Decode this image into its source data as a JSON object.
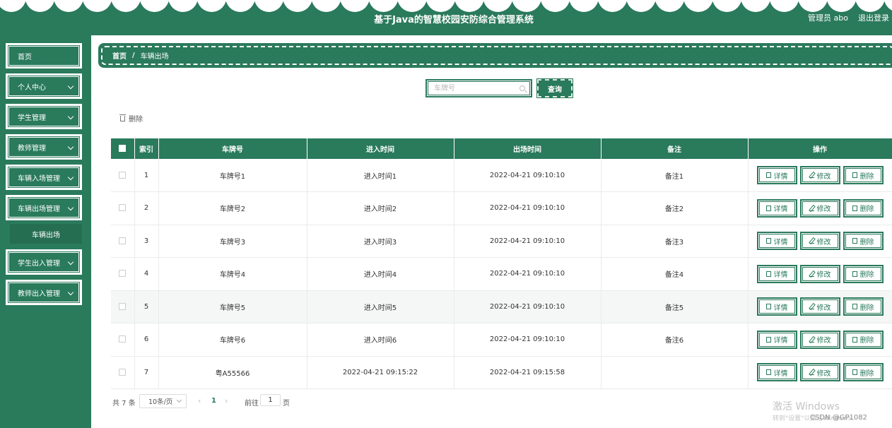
{
  "header": {
    "title": "基于Java的智慧校园安防综合管理系统",
    "admin": "管理员 abo",
    "logout": "退出登录"
  },
  "sidebar": {
    "items": [
      {
        "label": "首页",
        "has_arrow": false
      },
      {
        "label": "个人中心",
        "has_arrow": true
      },
      {
        "label": "学生管理",
        "has_arrow": true
      },
      {
        "label": "教师管理",
        "has_arrow": true
      },
      {
        "label": "车辆入场管理",
        "has_arrow": true
      },
      {
        "label": "车辆出场管理",
        "has_arrow": true
      },
      {
        "label": "学生出入管理",
        "has_arrow": true
      },
      {
        "label": "教师出入管理",
        "has_arrow": true
      }
    ],
    "active_sub": "车辆出场"
  },
  "breadcrumb": {
    "home": "首页",
    "separator": "/",
    "current": "车辆出场"
  },
  "search": {
    "placeholder": "车牌号",
    "value": "",
    "button": "查询"
  },
  "toolbar": {
    "delete": "删除"
  },
  "table": {
    "columns": [
      "索引",
      "车牌号",
      "进入时间",
      "出场时间",
      "备注",
      "操作"
    ],
    "rows": [
      {
        "index": "1",
        "plate": "车牌号1",
        "entry": "进入时间1",
        "exit": "2022-04-21 09:10:10",
        "note": "备注1"
      },
      {
        "index": "2",
        "plate": "车牌号2",
        "entry": "进入时间2",
        "exit": "2022-04-21 09:10:10",
        "note": "备注2"
      },
      {
        "index": "3",
        "plate": "车牌号3",
        "entry": "进入时间3",
        "exit": "2022-04-21 09:10:10",
        "note": "备注3"
      },
      {
        "index": "4",
        "plate": "车牌号4",
        "entry": "进入时间4",
        "exit": "2022-04-21 09:10:10",
        "note": "备注4"
      },
      {
        "index": "5",
        "plate": "车牌号5",
        "entry": "进入时间5",
        "exit": "2022-04-21 09:10:10",
        "note": "备注5"
      },
      {
        "index": "6",
        "plate": "车牌号6",
        "entry": "进入时间6",
        "exit": "2022-04-21 09:10:10",
        "note": "备注6"
      },
      {
        "index": "7",
        "plate": "粤A55566",
        "entry": "2022-04-21 09:15:22",
        "exit": "2022-04-21 09:15:58",
        "note": ""
      }
    ],
    "actions": {
      "detail": "详情",
      "edit": "修改",
      "delete": "删除"
    },
    "highlighted_row": 4
  },
  "pagination": {
    "total": "共 7 条",
    "page_size": "10条/页",
    "current_page": "1",
    "goto_label": "前往",
    "goto_value": "1",
    "page_suffix": "页"
  },
  "watermark": {
    "line1": "激活 Windows",
    "line2": "转到\"设置\"以激活Windows。",
    "csdn": "CSDN @GP1082"
  },
  "colors": {
    "primary": "#2a7a5c",
    "white": "#ffffff"
  }
}
